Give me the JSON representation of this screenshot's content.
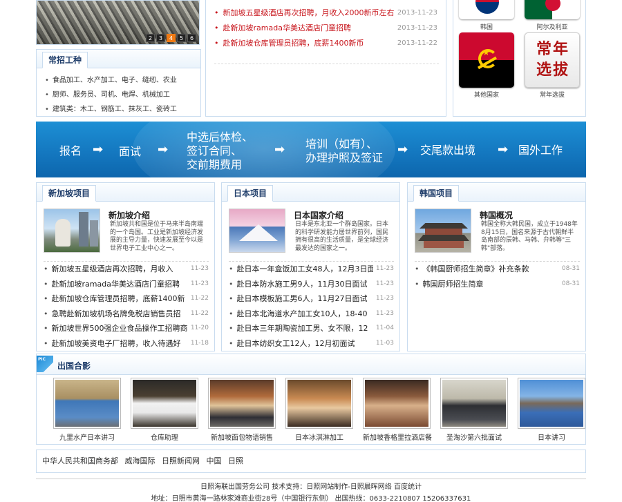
{
  "slideshow": {
    "pages": [
      "2",
      "3",
      "4",
      "5",
      "6"
    ],
    "active_index": 2
  },
  "jobs": {
    "title": "常招工种",
    "items": [
      "食品加工、水产加工、电子、缝纫、农业",
      "厨师、服务员、司机、电焊、机械加工",
      "建筑类：木工、钢筋工、抹灰工、瓷砖工"
    ]
  },
  "news_top": [
    {
      "title": "新加坡五星级酒店再次招聘，月收入2000新币左右",
      "date": "2013-11-23"
    },
    {
      "title": "赴新加坡ramada华美达酒店门童招聘",
      "date": "2013-11-23"
    },
    {
      "title": "赴新加坡仓库管理员招聘，底薪1400新币",
      "date": "2013-11-22"
    }
  ],
  "flags": {
    "korea": "韩国",
    "algeria": "阿尔及利亚",
    "others": "其他国家",
    "regular": "常年选拔",
    "regular_img_text": "常年选拔"
  },
  "banner": {
    "step1": "报名",
    "step2": "面试",
    "step3_l1": "中选后体检、",
    "step3_l2": "签订合同、",
    "step3_l3": "交前期费用",
    "step4_l1": "培训（如有）、",
    "step4_l2": "办理护照及签证",
    "step5": "交尾款出境",
    "step6": "国外工作",
    "arrow": "➡"
  },
  "singapore": {
    "tab": "新加坡项目",
    "intro_title": "新加坡介绍",
    "intro_text": "新加坡共和国是位于马来半岛南端的一个岛国。工业是新加坡经济发展的主导力量，快速发展至今以是世界电子工业中心之一。",
    "items": [
      {
        "title": "新加坡五星级酒店再次招聘，月收入",
        "date": "11-23"
      },
      {
        "title": "赴新加坡ramada华美达酒店门童招聘",
        "date": "11-23"
      },
      {
        "title": "赴新加坡仓库管理员招聘，底薪1400新",
        "date": "11-22"
      },
      {
        "title": "急聘赴新加坡机场名牌免税店销售员招",
        "date": "11-22"
      },
      {
        "title": "新加坡世界500强企业食品操作工招聘商",
        "date": "11-20"
      },
      {
        "title": "赴新加坡美资电子厂招聘，收入待遇好",
        "date": "11-18"
      }
    ]
  },
  "japan": {
    "tab": "日本项目",
    "intro_title": "日本国家介绍",
    "intro_text": "日本是东北亚一个群岛国家。日本的科学研发能力居世界前列，国民拥有很高的生活质量，是全球经济最发达的国家之一。",
    "items": [
      {
        "title": "赴日本一年盒饭加工女48人，12月3日面",
        "date": "11-23"
      },
      {
        "title": "赴日本防水施工男9人，11月30日面试",
        "date": "11-23"
      },
      {
        "title": "赴日本模板施工男6人，11月27日面试",
        "date": "11-23"
      },
      {
        "title": "赴日本北海道水产加工女10人，18-40",
        "date": "11-23"
      },
      {
        "title": "赴日本三年期陶瓷加工男、女不限，12",
        "date": "11-04"
      },
      {
        "title": "赴日本纺织女工12人，12月初面试",
        "date": "11-03"
      }
    ]
  },
  "korea": {
    "tab": "韩国项目",
    "intro_title": "韩国概况",
    "intro_text": "韩国全称大韩民国，成立于1948年8月15日，国名来源于古代朝鲜半岛南部的辰韩、马韩、弁韩等\"三韩\"部落。",
    "items": [
      {
        "title": "《韩国厨师招生简章》补充条款",
        "date": "08-31"
      },
      {
        "title": "韩国厨师招生简章",
        "date": "08-31"
      }
    ]
  },
  "photos": {
    "title": "出国合影",
    "badge": "PIC",
    "items": [
      "九里水产日本讲习",
      "仓库助理",
      "新加坡面包物语销售",
      "日本冰淇淋加工",
      "新加坡香格里拉酒店餐",
      "圣淘沙第六批面试",
      "日本讲习"
    ]
  },
  "links": [
    "中华人民共和国商务部",
    "威海国际",
    "日照新闻网",
    "中国",
    "日照"
  ],
  "footer": {
    "line1": "日照海联出国劳务公司  技术支持：日照网站制作-日照晨晖网络 百度统计",
    "line2": "地址：日照市黄海一路林家滩商业街28号（中国银行东侧） 出国热线：0633-2210807 15206337631"
  }
}
